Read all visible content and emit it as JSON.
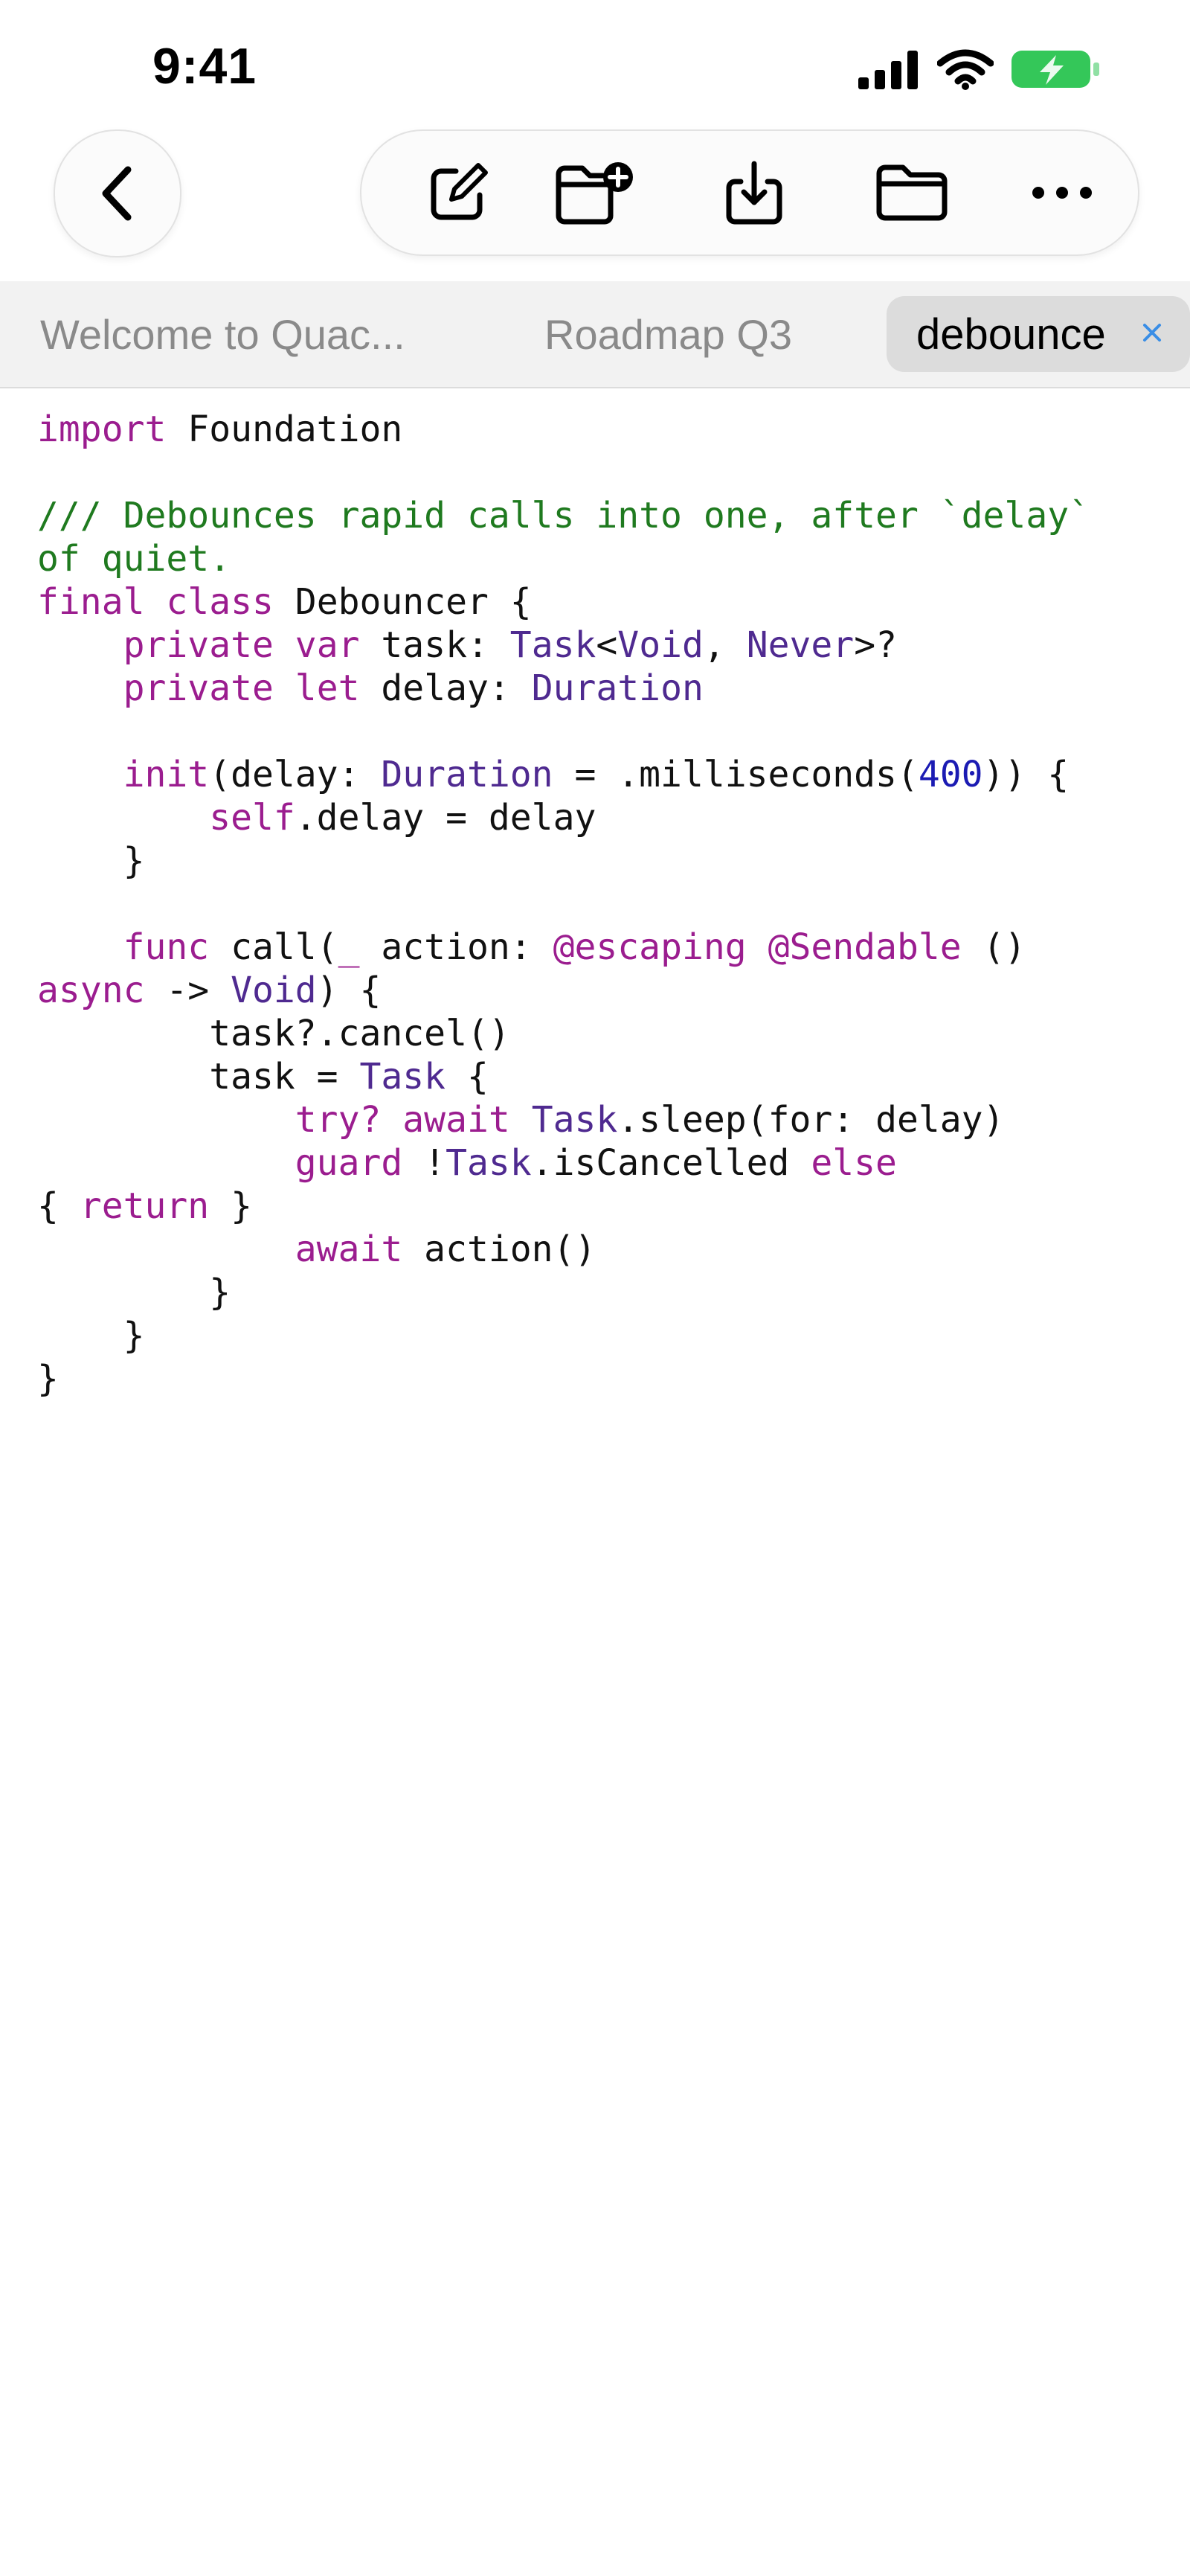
{
  "status_bar": {
    "time": "9:41",
    "icons": [
      "cellular-signal-icon",
      "wifi-icon",
      "battery-charging-icon"
    ],
    "battery_color": "#34c759"
  },
  "toolbar": {
    "back_icon": "chevron-left-icon",
    "actions": [
      "compose-icon",
      "new-folder-icon",
      "download-icon",
      "folder-icon",
      "more-icon"
    ]
  },
  "tabs": [
    {
      "label": "Welcome to Quac...",
      "active": false
    },
    {
      "label": "Roadmap Q3",
      "active": false
    },
    {
      "label": "debounce",
      "active": true
    }
  ],
  "editor": {
    "language": "swift",
    "colors": {
      "keyword": "#9b1d8f",
      "type": "#4f2a90",
      "comment": "#1f7a1f",
      "number": "#1b1bb3",
      "text": "#111111"
    },
    "lines": [
      [
        [
          "kw",
          "import"
        ],
        [
          "tx",
          " Foundation"
        ]
      ],
      [],
      [
        [
          "cm",
          "/// Debounces rapid calls into one, after `delay`"
        ]
      ],
      [
        [
          "cm",
          "of quiet."
        ]
      ],
      [
        [
          "kw",
          "final"
        ],
        [
          "tx",
          " "
        ],
        [
          "kw",
          "class"
        ],
        [
          "tx",
          " Debouncer {"
        ]
      ],
      [
        [
          "tx",
          "    "
        ],
        [
          "kw",
          "private"
        ],
        [
          "tx",
          " "
        ],
        [
          "kw",
          "var"
        ],
        [
          "tx",
          " task: "
        ],
        [
          "ty",
          "Task"
        ],
        [
          "tx",
          "<"
        ],
        [
          "ty",
          "Void"
        ],
        [
          "tx",
          ", "
        ],
        [
          "ty",
          "Never"
        ],
        [
          "tx",
          ">?"
        ]
      ],
      [
        [
          "tx",
          "    "
        ],
        [
          "kw",
          "private"
        ],
        [
          "tx",
          " "
        ],
        [
          "kw",
          "let"
        ],
        [
          "tx",
          " delay: "
        ],
        [
          "ty",
          "Duration"
        ]
      ],
      [],
      [
        [
          "tx",
          "    "
        ],
        [
          "kw",
          "init"
        ],
        [
          "tx",
          "(delay: "
        ],
        [
          "ty",
          "Duration"
        ],
        [
          "tx",
          " = .milliseconds("
        ],
        [
          "nu",
          "400"
        ],
        [
          "tx",
          ")) {"
        ]
      ],
      [
        [
          "tx",
          "        "
        ],
        [
          "kw",
          "self"
        ],
        [
          "tx",
          ".delay = delay"
        ]
      ],
      [
        [
          "tx",
          "    }"
        ]
      ],
      [],
      [
        [
          "tx",
          "    "
        ],
        [
          "kw",
          "func"
        ],
        [
          "tx",
          " call("
        ],
        [
          "kw",
          "_"
        ],
        [
          "tx",
          " action: "
        ],
        [
          "kw",
          "@escaping"
        ],
        [
          "tx",
          " "
        ],
        [
          "kw",
          "@Sendable"
        ],
        [
          "tx",
          " ()"
        ]
      ],
      [
        [
          "kw",
          "async"
        ],
        [
          "tx",
          " -> "
        ],
        [
          "ty",
          "Void"
        ],
        [
          "tx",
          ") {"
        ]
      ],
      [
        [
          "tx",
          "        task?.cancel()"
        ]
      ],
      [
        [
          "tx",
          "        task = "
        ],
        [
          "ty",
          "Task"
        ],
        [
          "tx",
          " {"
        ]
      ],
      [
        [
          "tx",
          "            "
        ],
        [
          "kw",
          "try?"
        ],
        [
          "tx",
          " "
        ],
        [
          "kw",
          "await"
        ],
        [
          "tx",
          " "
        ],
        [
          "ty",
          "Task"
        ],
        [
          "tx",
          ".sleep(for: delay)"
        ]
      ],
      [
        [
          "tx",
          "            "
        ],
        [
          "kw",
          "guard"
        ],
        [
          "tx",
          " !"
        ],
        [
          "ty",
          "Task"
        ],
        [
          "tx",
          ".isCancelled "
        ],
        [
          "kw",
          "else"
        ]
      ],
      [
        [
          "tx",
          "{ "
        ],
        [
          "kw",
          "return"
        ],
        [
          "tx",
          " }"
        ]
      ],
      [
        [
          "tx",
          "            "
        ],
        [
          "kw",
          "await"
        ],
        [
          "tx",
          " action()"
        ]
      ],
      [
        [
          "tx",
          "        }"
        ]
      ],
      [
        [
          "tx",
          "    }"
        ]
      ],
      [
        [
          "tx",
          "}"
        ]
      ]
    ]
  }
}
